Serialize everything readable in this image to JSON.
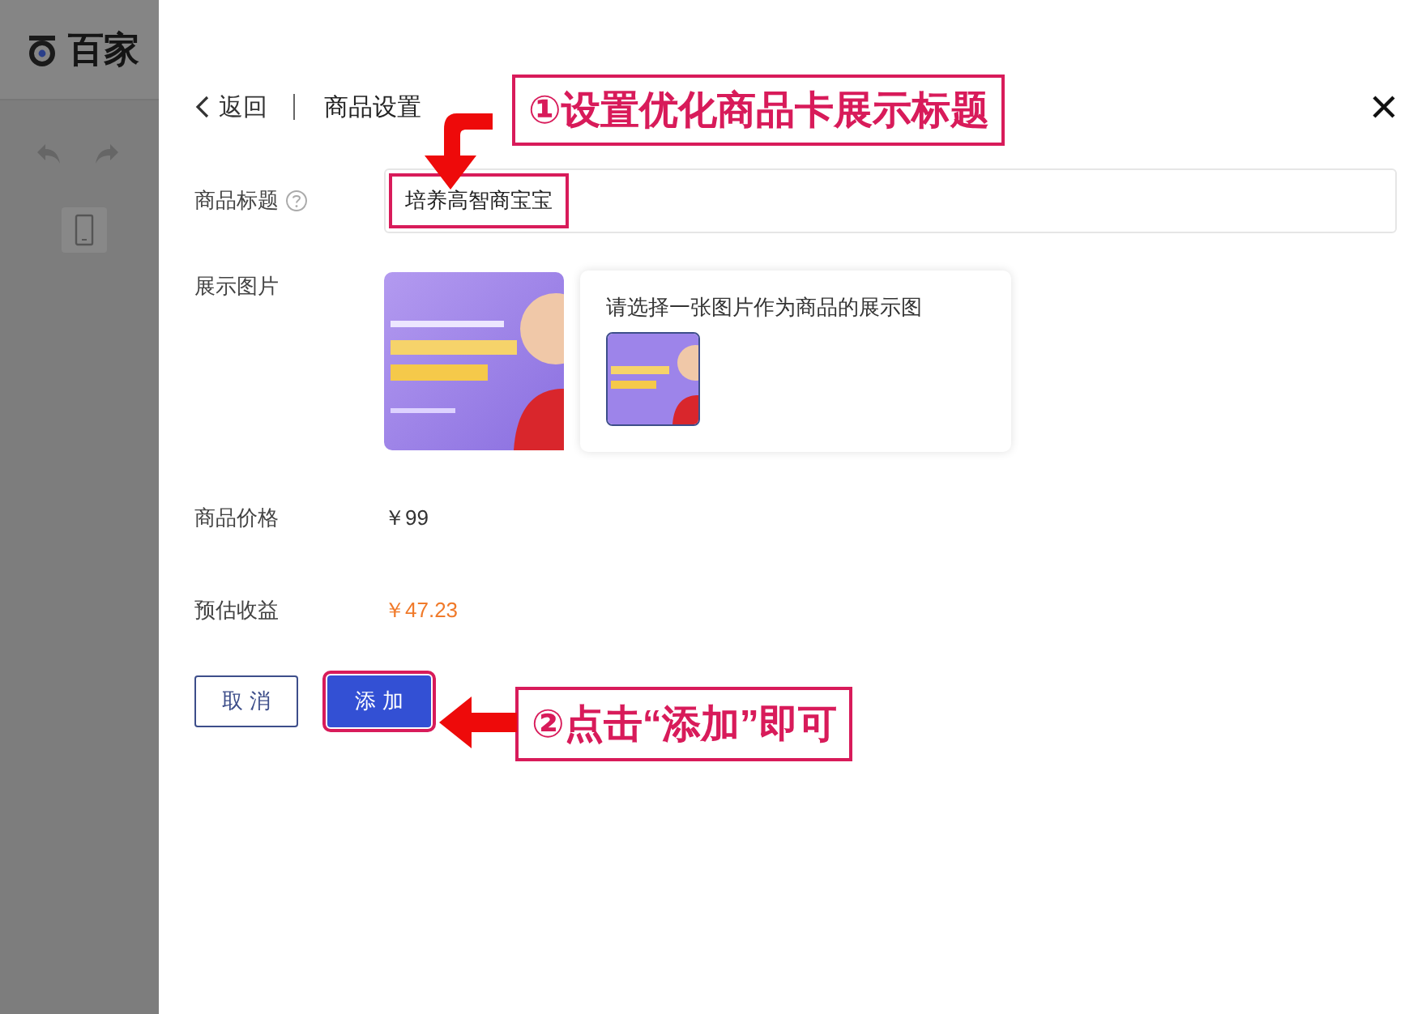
{
  "background": {
    "logo_text": "百家"
  },
  "dialog": {
    "back": "返回",
    "title": "商品设置",
    "fields": [
      {
        "kind": "text",
        "label": "商品标题",
        "help": true,
        "value": "培养高智商宝宝",
        "highlighted": true
      },
      {
        "label": "展示图片",
        "popover": {
          "text": "请选择一张图片作为商品的展示图",
          "thumbs": [
            {
              "selected": true
            }
          ]
        }
      },
      {
        "kind": "price",
        "label": "商品价格",
        "value": "￥99"
      },
      {
        "kind": "earning",
        "label": "预估收益",
        "value": "￥47.23"
      }
    ],
    "buttons": [
      {
        "kind": "secondary",
        "label": "取 消",
        "highlighted": false
      },
      {
        "kind": "primary",
        "label": "添 加",
        "highlighted": true
      }
    ]
  },
  "annotations": [
    {
      "text": "①设置优化商品卡展示标题"
    },
    {
      "text": "②点击“添加”即可"
    }
  ]
}
